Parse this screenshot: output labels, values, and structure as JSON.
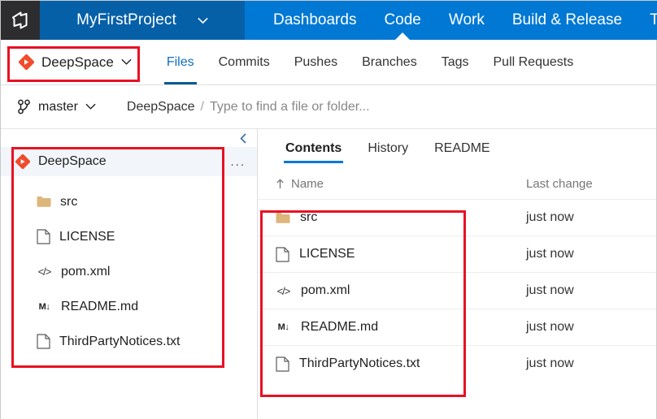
{
  "topbar": {
    "logo_icon": "azure-devops-logo-icon",
    "project_name": "MyFirstProject",
    "project_chevron_icon": "chevron-down-icon",
    "nav_items": [
      {
        "label": "Dashboards",
        "active": false
      },
      {
        "label": "Code",
        "active": true
      },
      {
        "label": "Work",
        "active": false
      },
      {
        "label": "Build & Release",
        "active": false
      },
      {
        "label": "Test",
        "active": false
      }
    ]
  },
  "repobar": {
    "repo_icon": "git-repository-icon",
    "repo_name": "DeepSpace",
    "repo_chevron_icon": "chevron-down-icon",
    "tabs": [
      {
        "label": "Files",
        "active": true
      },
      {
        "label": "Commits",
        "active": false
      },
      {
        "label": "Pushes",
        "active": false
      },
      {
        "label": "Branches",
        "active": false
      },
      {
        "label": "Tags",
        "active": false
      },
      {
        "label": "Pull Requests",
        "active": false
      }
    ]
  },
  "pathbar": {
    "branch_icon": "git-branch-icon",
    "branch_name": "master",
    "branch_chevron_icon": "chevron-down-icon",
    "crumb_repo": "DeepSpace",
    "crumb_separator": "/",
    "search_placeholder": "Type to find a file or folder..."
  },
  "sidebar": {
    "collapse_icon": "chevron-left-icon",
    "more_menu": "...",
    "root": {
      "label": "DeepSpace",
      "icon": "git-repository-icon"
    },
    "items": [
      {
        "label": "src",
        "icon": "folder-icon"
      },
      {
        "label": "LICENSE",
        "icon": "file-icon"
      },
      {
        "label": "pom.xml",
        "icon": "code-file-icon"
      },
      {
        "label": "README.md",
        "icon": "markdown-file-icon"
      },
      {
        "label": "ThirdPartyNotices.txt",
        "icon": "file-icon"
      }
    ]
  },
  "main": {
    "tabs": [
      {
        "label": "Contents",
        "active": true
      },
      {
        "label": "History",
        "active": false
      },
      {
        "label": "README",
        "active": false
      }
    ],
    "columns": {
      "sort_icon": "sort-ascending-icon",
      "name": "Name",
      "last_change": "Last change"
    },
    "rows": [
      {
        "name": "src",
        "icon": "folder-icon",
        "last_change": "just now"
      },
      {
        "name": "LICENSE",
        "icon": "file-icon",
        "last_change": "just now"
      },
      {
        "name": "pom.xml",
        "icon": "code-file-icon",
        "last_change": "just now"
      },
      {
        "name": "README.md",
        "icon": "markdown-file-icon",
        "last_change": "just now"
      },
      {
        "name": "ThirdPartyNotices.txt",
        "icon": "file-icon",
        "last_change": "just now"
      }
    ]
  },
  "colors": {
    "nav_blue": "#0078d4",
    "project_blue": "#0660a8",
    "logo_dark": "#2d2d30",
    "repo_red": "#f04c2c",
    "folder_tan": "#dcb67a",
    "annotation_red": "#e81123"
  },
  "annotations": [
    {
      "name": "repo-picker-highlight"
    },
    {
      "name": "sidebar-tree-highlight"
    },
    {
      "name": "file-list-highlight"
    }
  ]
}
